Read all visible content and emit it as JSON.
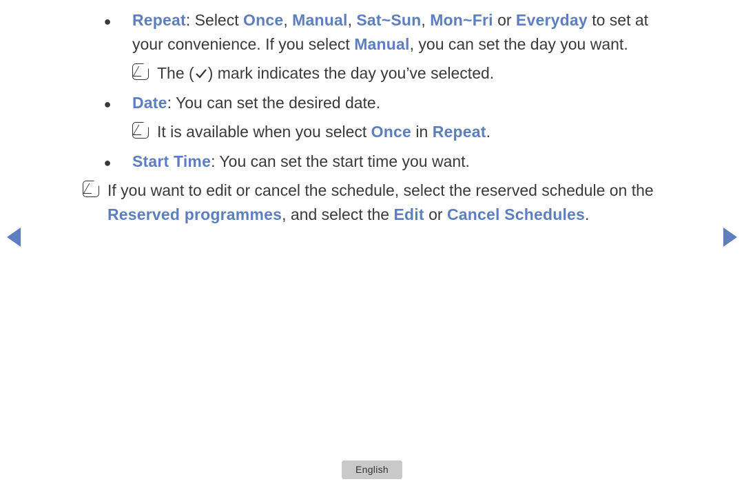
{
  "items": {
    "repeat": {
      "label": "Repeat",
      "lead": ": Select ",
      "opt1": "Once",
      "sep1": ", ",
      "opt2": "Manual",
      "sep2": ", ",
      "opt3": "Sat~Sun",
      "sep3": ", ",
      "opt4": "Mon~Fri",
      "sep4": " or ",
      "opt5": "Everyday",
      "tail1": " to set at your convenience. If you select ",
      "opt6": "Manual",
      "tail2": ", you can set the day you want.",
      "note_pre": "The (",
      "note_post": ") mark indicates the day you’ve selected."
    },
    "date": {
      "label": "Date",
      "text": ": You can set the desired date.",
      "note_pre": "It is available when you select ",
      "once": "Once",
      "mid": " in ",
      "repeat": "Repeat",
      "end": "."
    },
    "start": {
      "label": "Start Time",
      "text": ": You can set the start time you want."
    }
  },
  "footnote": {
    "pre": "If you want to edit or cancel the schedule, select the reserved schedule on the ",
    "rp": "Reserved programmes",
    "mid1": ", and select the ",
    "edit": "Edit",
    "mid2": " or ",
    "cs": "Cancel Schedules",
    "end": "."
  },
  "lang": "English"
}
